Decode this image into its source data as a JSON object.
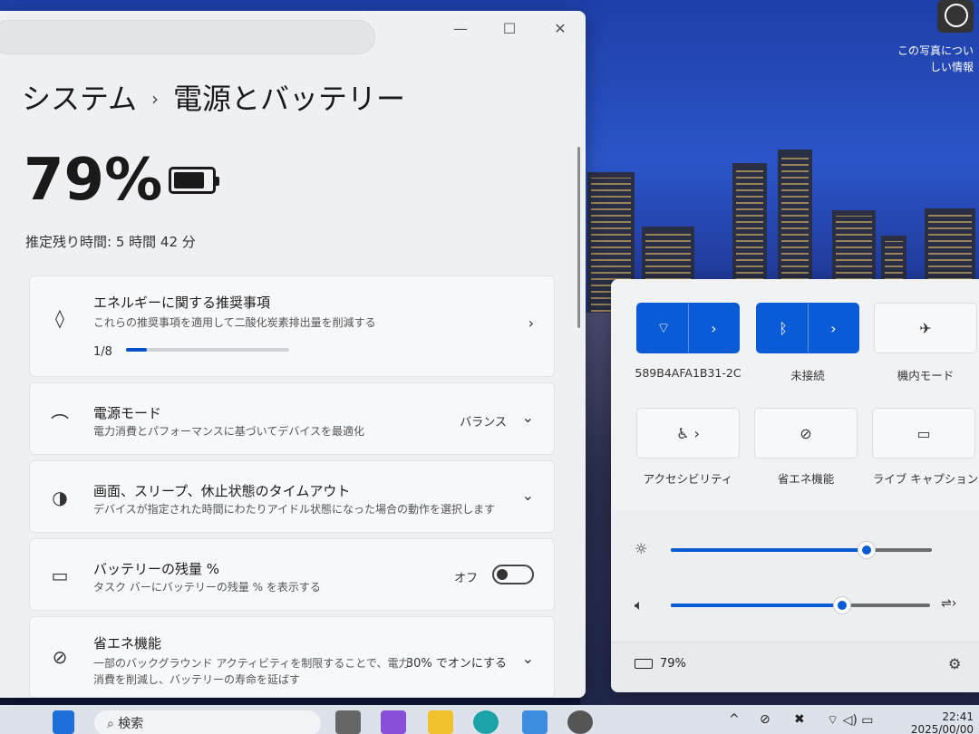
{
  "window": {
    "breadcrumb_parent": "システム",
    "breadcrumb_sep": "›",
    "page_title": "電源とバッテリー",
    "minimize": "—",
    "maximize": "☐",
    "close": "✕"
  },
  "battery": {
    "percent": "79%",
    "remaining": "推定残り時間: 5 時間 42 分"
  },
  "cards": {
    "energy": {
      "title": "エネルギーに関する推奨事項",
      "desc": "これらの推奨事項を適用して二酸化炭素排出量を削減する",
      "progress_text": "1/8",
      "progress_fraction": 0.125,
      "chevron": "›"
    },
    "power_mode": {
      "title": "電源モード",
      "desc": "電力消費とパフォーマンスに基づいてデバイスを最適化",
      "value": "バランス",
      "chevron": "⌄"
    },
    "screen_sleep": {
      "title": "画面、スリープ、休止状態のタイムアウト",
      "desc": "デバイスが指定された時間にわたりアイドル状態になった場合の動作を選択します",
      "chevron": "⌄"
    },
    "battery_pct": {
      "title": "バッテリーの残量 %",
      "desc": "タスク バーにバッテリーの残量 % を表示する",
      "toggle_label": "オフ"
    },
    "saver": {
      "title": "省エネ機能",
      "desc_line1": "一部のバックグラウンド アクティビティを制限することで、電力",
      "desc_line2": "消費を削減し、バッテリーの寿命を延ばす",
      "value": "30% でオンにする",
      "chevron": "⌄"
    }
  },
  "quick_settings": {
    "wifi_label": "589B4AFA1B31-2C",
    "bluetooth_label": "未接続",
    "airplane_label": "機内モード",
    "accessibility_label": "アクセシビリティ",
    "saver_label": "省エネ機能",
    "captions_label": "ライブ キャプション",
    "brightness_level": 0.75,
    "volume_level": 0.66,
    "battery_text": "79%",
    "tile_arrow": "›"
  },
  "photo_info": {
    "line1": "この写真につい",
    "line2": "しい情報"
  },
  "taskbar": {
    "search_placeholder": "検索",
    "clock_time": "22:41",
    "clock_date": "2025/00/00"
  },
  "colors": {
    "accent": "#0a5bd6"
  }
}
